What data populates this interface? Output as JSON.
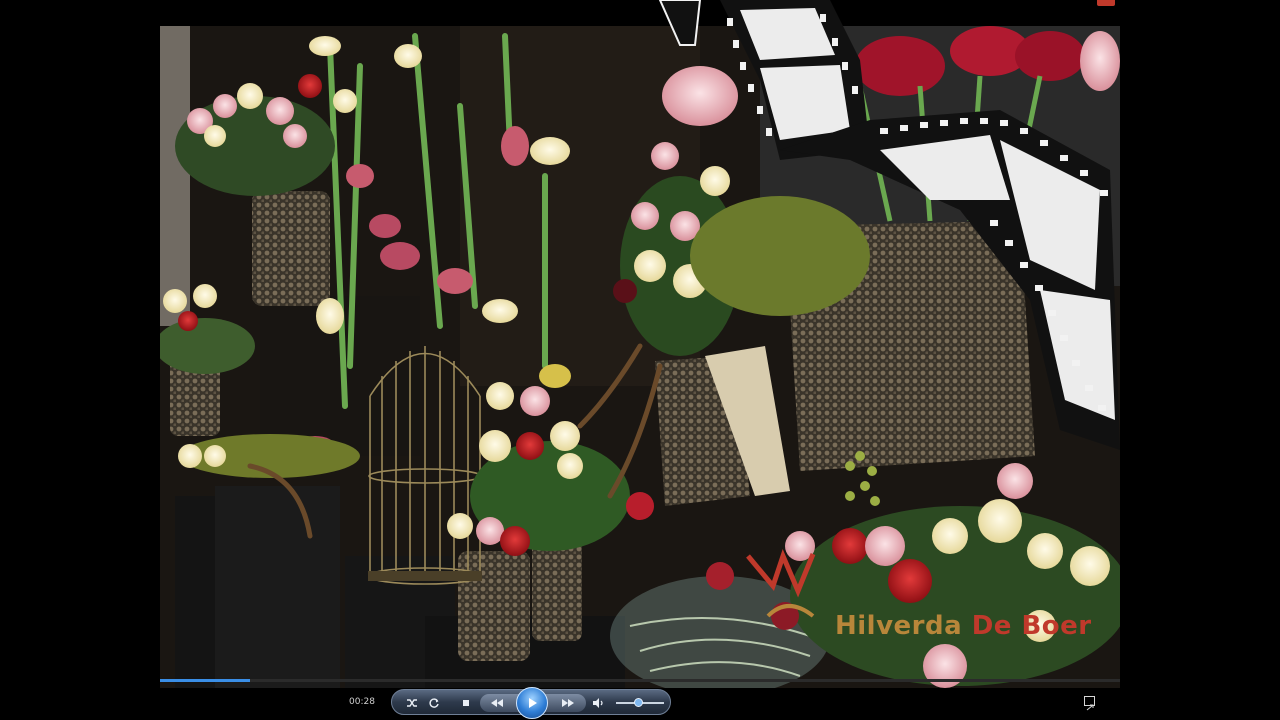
{
  "window": {
    "close_label": ""
  },
  "video": {
    "watermark": {
      "text_part1": "Hilverda",
      "text_part2": "De Boer"
    }
  },
  "playback": {
    "time": "00:28",
    "progress": 0.094,
    "volume": 0.45
  },
  "controls": {
    "shuffle_icon": "shuffle-icon",
    "repeat_icon": "repeat-icon",
    "stop_icon": "stop-icon",
    "rewind_icon": "rewind-icon",
    "play_icon": "play-icon",
    "forward_icon": "fast-forward-icon",
    "volume_icon": "speaker-icon",
    "fullscreen_icon": "fullscreen-icon"
  },
  "colors": {
    "accent": "#3a8ee6",
    "watermark_gold": "#b8863a",
    "watermark_red": "#c0392b"
  }
}
